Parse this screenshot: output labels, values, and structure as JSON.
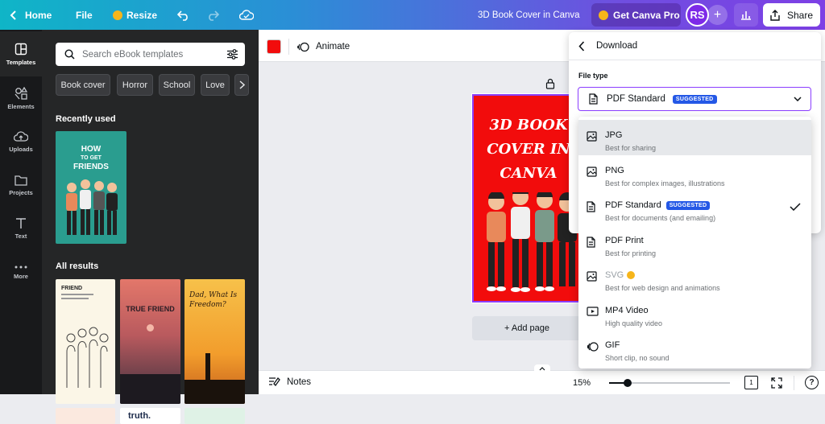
{
  "topbar": {
    "home_label": "Home",
    "file_label": "File",
    "resize_label": "Resize",
    "doc_title": "3D Book Cover in Canva",
    "pro_label": "Get Canva Pro",
    "avatar_initials": "RS",
    "share_label": "Share"
  },
  "leftrail": {
    "items": [
      {
        "label": "Templates",
        "icon": "templates-icon"
      },
      {
        "label": "Elements",
        "icon": "elements-icon"
      },
      {
        "label": "Uploads",
        "icon": "uploads-icon"
      },
      {
        "label": "Projects",
        "icon": "folder-icon"
      },
      {
        "label": "Text",
        "icon": "text-icon"
      },
      {
        "label": "More",
        "icon": "more-icon"
      }
    ]
  },
  "panel": {
    "search_placeholder": "Search eBook templates",
    "chips": [
      "Book cover",
      "Horror",
      "School",
      "Love"
    ],
    "recently_used_title": "Recently used",
    "recent_thumb_text": [
      "HOW",
      "TO GET",
      "FRIENDS"
    ],
    "all_results_title": "All results",
    "results": [
      {
        "title": "FRIEND"
      },
      {
        "title": "TRUE FRIEND"
      },
      {
        "title": "Dad, What Is Freedom?"
      }
    ],
    "partial_results": [
      {
        "title": ""
      },
      {
        "title": "truth."
      },
      {
        "title": ""
      }
    ]
  },
  "context_bar": {
    "color_swatch": "#f20c0c",
    "animate_label": "Animate"
  },
  "canvas": {
    "book_title_lines": [
      "3D BOOK",
      "COVER IN",
      "CANVA"
    ],
    "add_page_label": "+ Add page"
  },
  "bottombar": {
    "notes_label": "Notes",
    "zoom": "15%",
    "zoom_fraction": 0.15,
    "page_count": "1"
  },
  "download": {
    "title": "Download",
    "file_type_label": "File type",
    "selected_type": "PDF Standard",
    "suggested_badge": "SUGGESTED",
    "options": [
      {
        "name": "JPG",
        "desc": "Best for sharing",
        "icon": "image-icon",
        "highlighted": true
      },
      {
        "name": "PNG",
        "desc": "Best for complex images, illustrations",
        "icon": "image-icon"
      },
      {
        "name": "PDF Standard",
        "desc": "Best for documents (and emailing)",
        "icon": "document-icon",
        "badge": "SUGGESTED",
        "selected": true
      },
      {
        "name": "PDF Print",
        "desc": "Best for printing",
        "icon": "document-icon"
      },
      {
        "name": "SVG",
        "desc": "Best for web design and animations",
        "icon": "image-icon",
        "pro": true,
        "disabled": true
      },
      {
        "name": "MP4 Video",
        "desc": "High quality video",
        "icon": "video-icon"
      },
      {
        "name": "GIF",
        "desc": "Short clip, no sound",
        "icon": "gif-icon"
      }
    ]
  },
  "colors": {
    "accent": "#8b3dff",
    "badge": "#2458e6",
    "cover_red": "#f20c0c"
  }
}
